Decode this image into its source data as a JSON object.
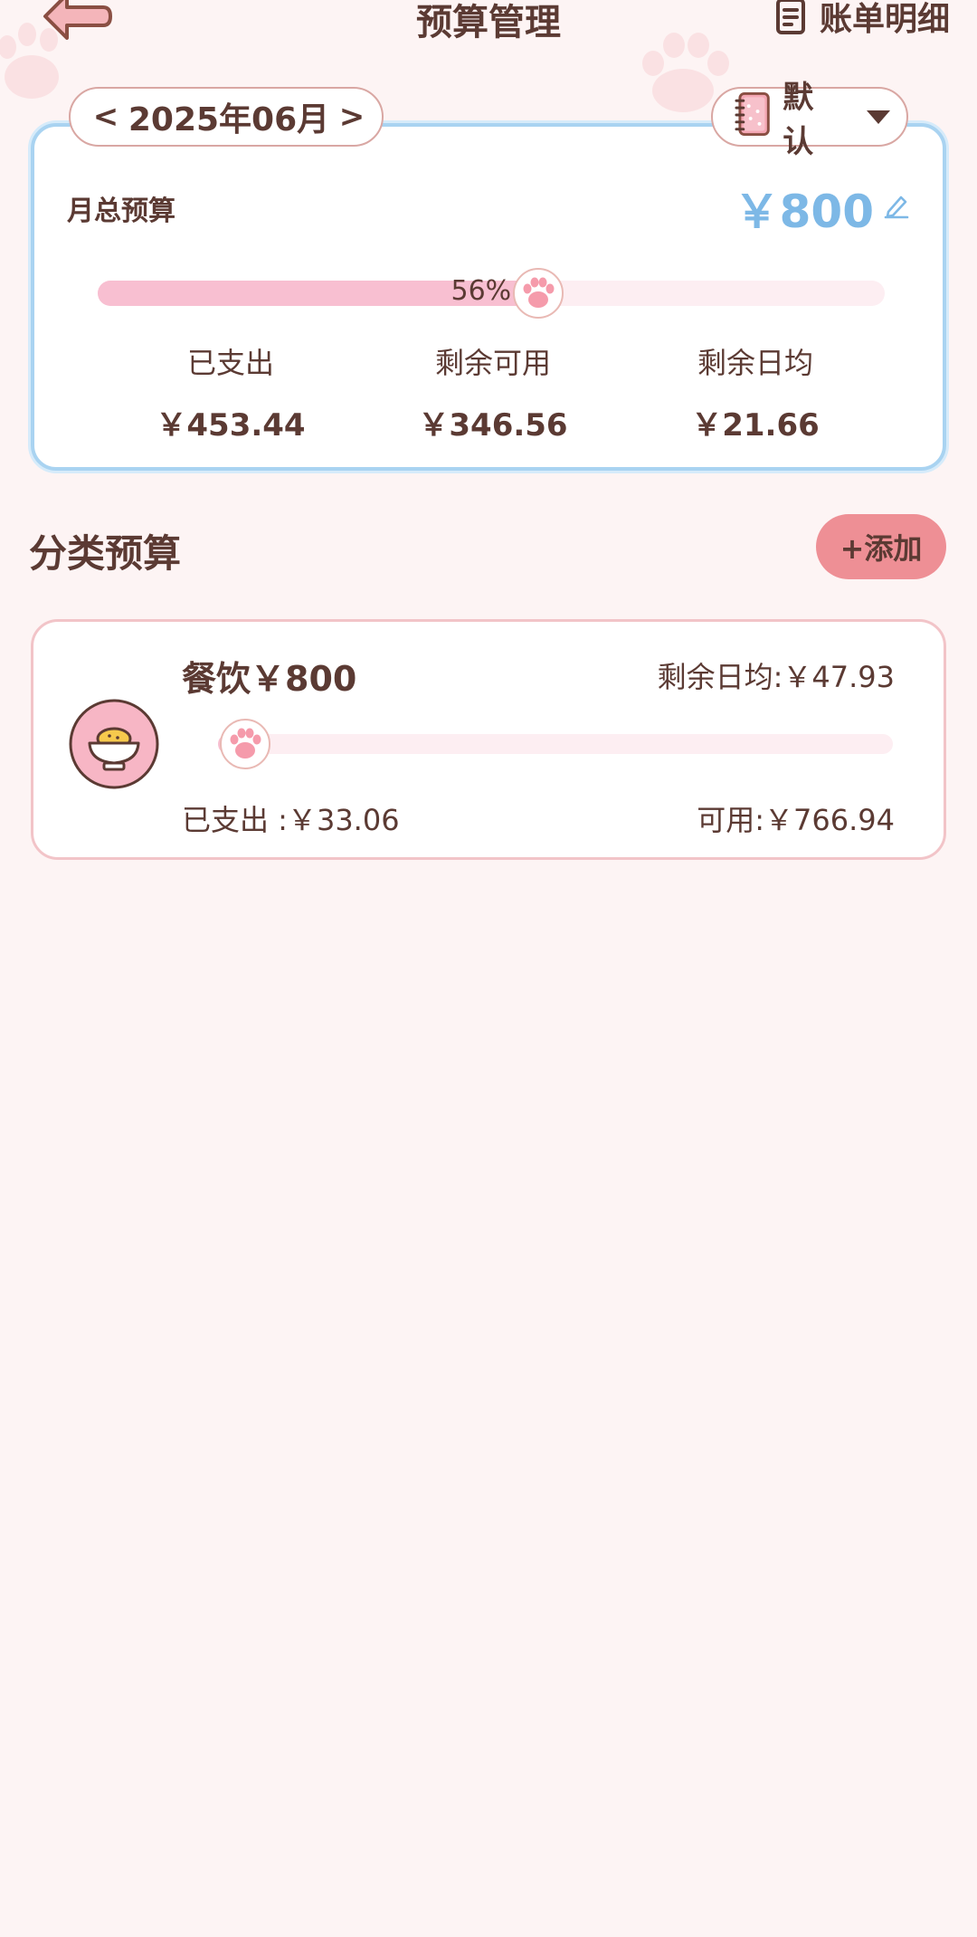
{
  "header": {
    "title": "预算管理",
    "bill_detail_label": "账单明细"
  },
  "selector": {
    "prev": "<",
    "month": "2025年06月",
    "next": ">",
    "book_label": "默认"
  },
  "total_budget": {
    "label": "月总预算",
    "amount": "￥800",
    "progress_text": "56%",
    "progress_value": 0.56,
    "stats": [
      {
        "label": "已支出",
        "value": "￥453.44"
      },
      {
        "label": "剩余可用",
        "value": "￥346.56"
      },
      {
        "label": "剩余日均",
        "value": "￥21.66"
      }
    ]
  },
  "category_section": {
    "title": "分类预算",
    "add_label": "+添加"
  },
  "categories": [
    {
      "name": "餐饮￥800",
      "daily_avg": "剩余日均:￥47.93",
      "spent": "已支出 :￥33.06",
      "available": "可用:￥766.94",
      "progress_value": 0.04,
      "icon": "rice-bowl-icon"
    }
  ],
  "colors": {
    "background": "#fdf4f4",
    "text": "#5b3a33",
    "accent_blue": "#7db8e6",
    "progress_pink": "#f8bfd1",
    "add_button": "#ee8f95",
    "card_border_blue": "#a9d3f1"
  }
}
